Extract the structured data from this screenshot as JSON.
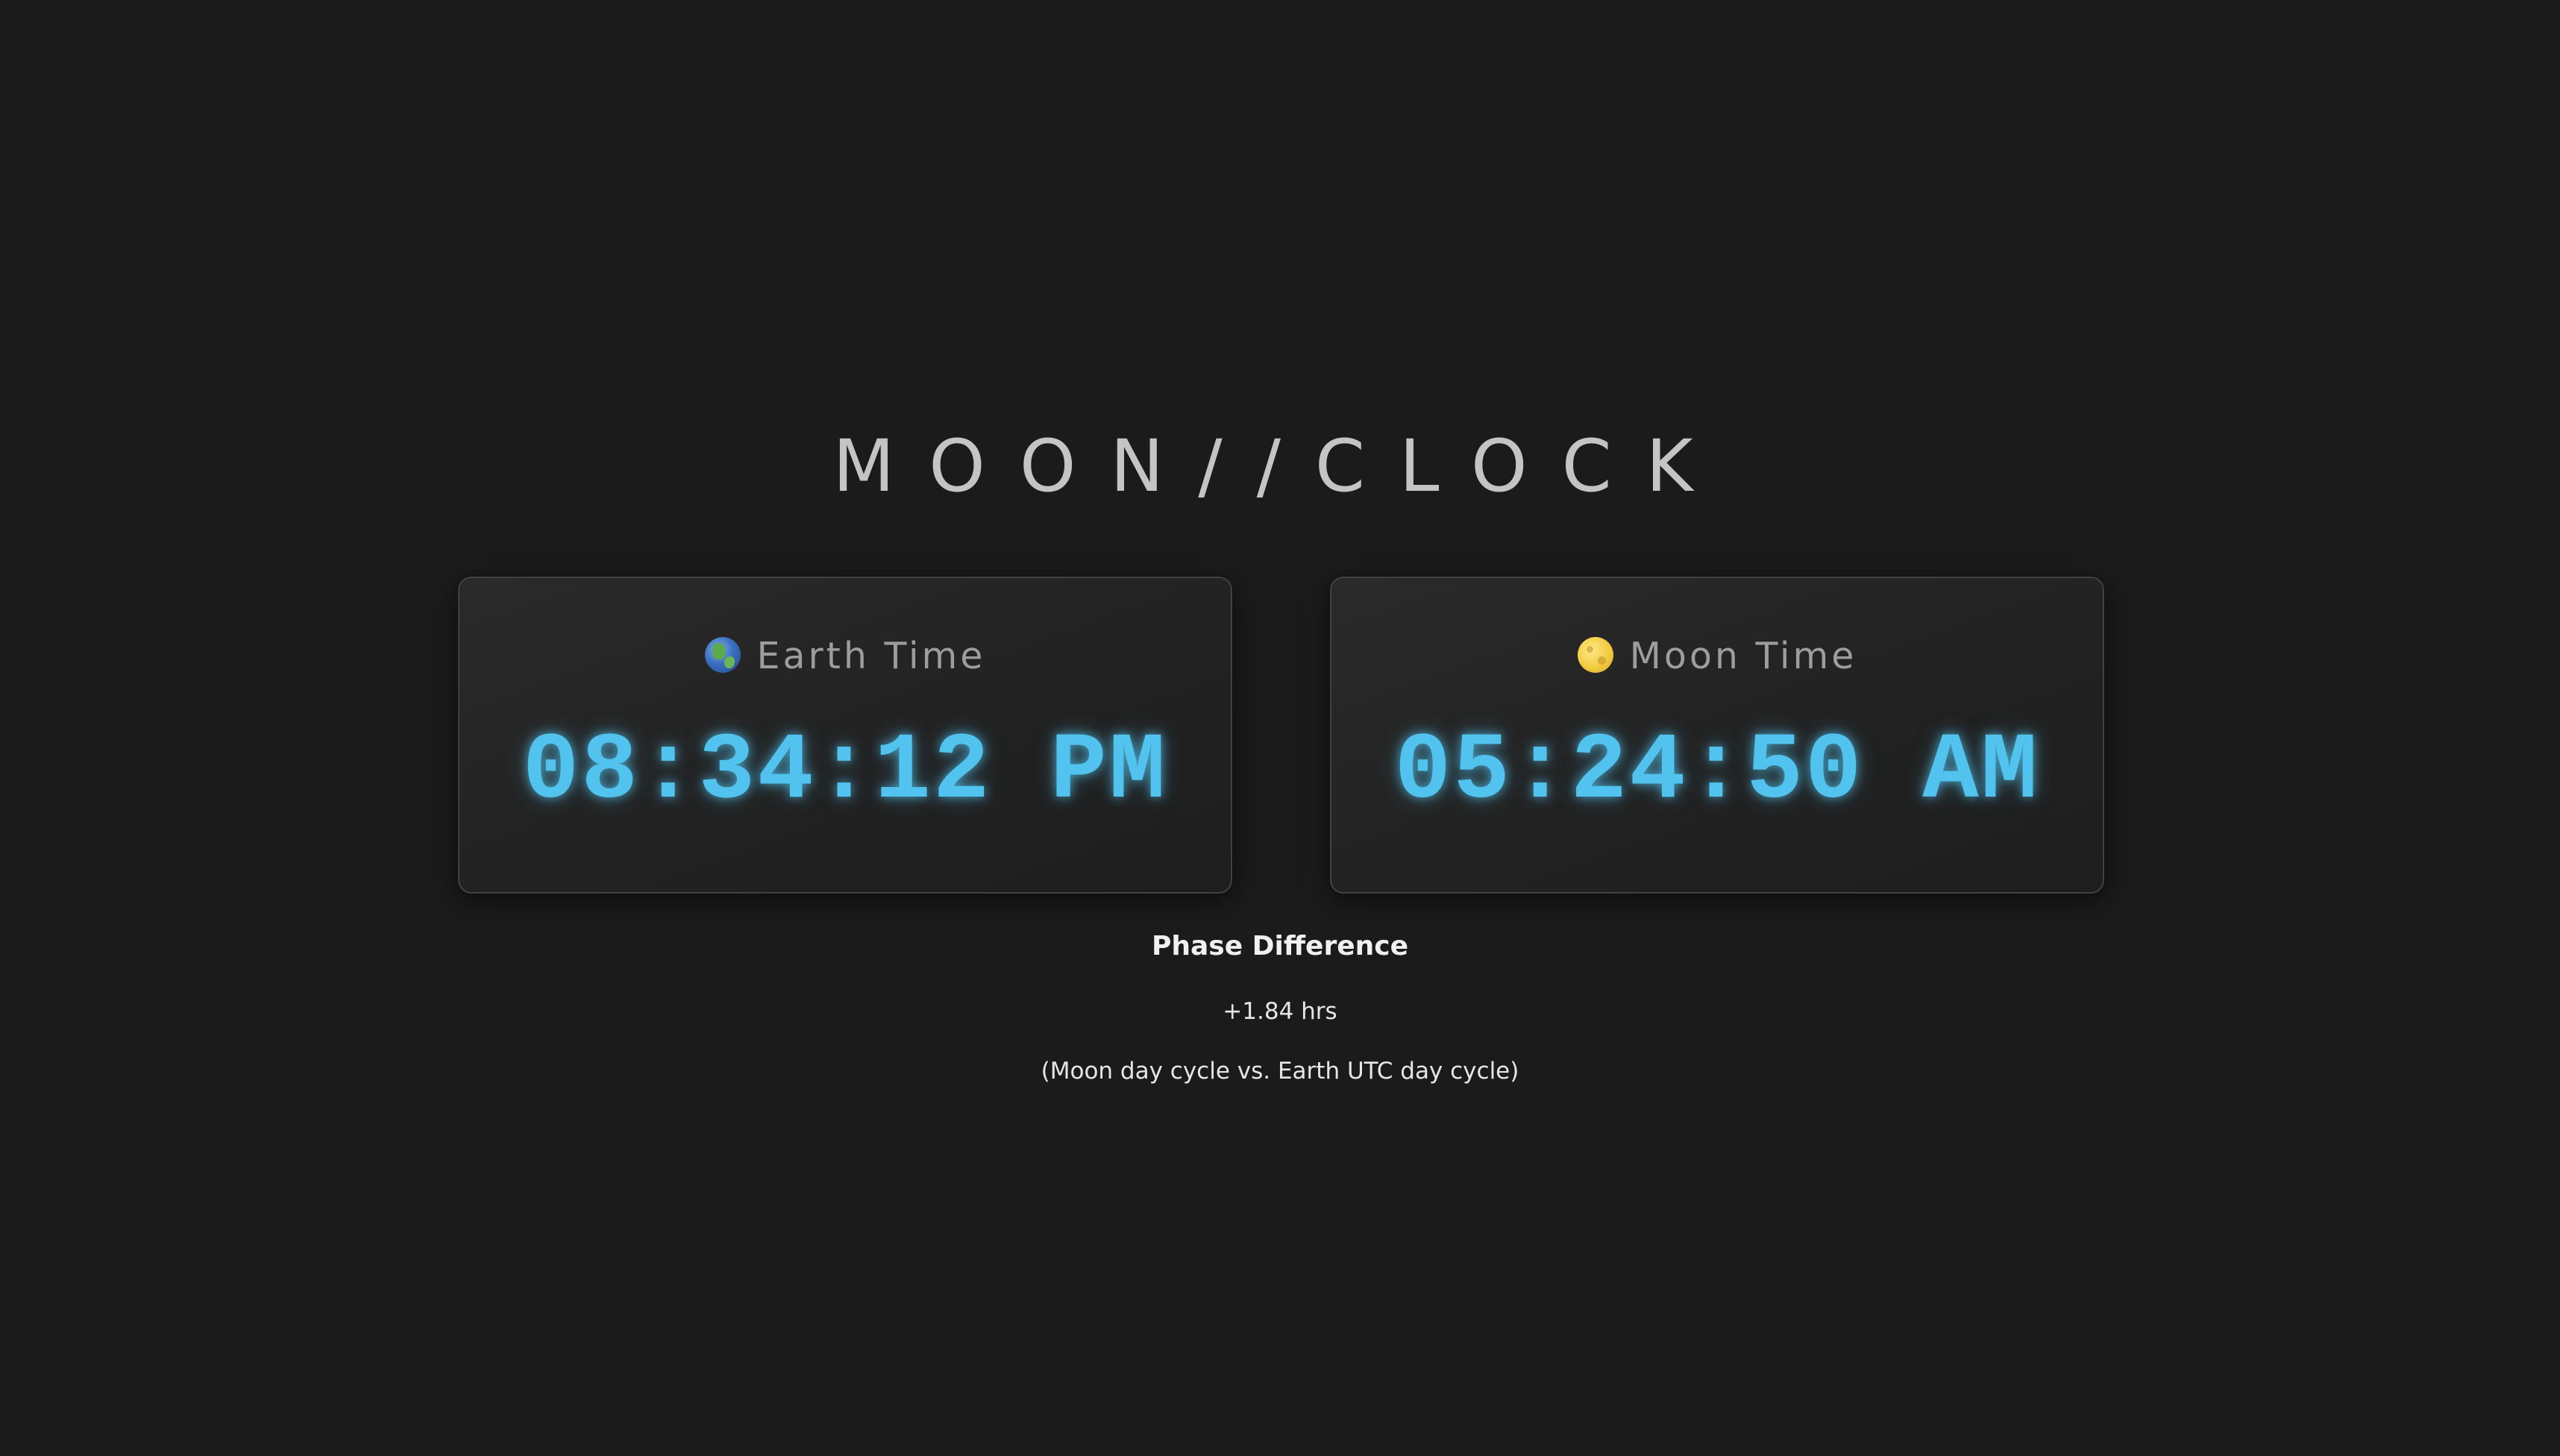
{
  "app": {
    "title": "MOON//CLOCK"
  },
  "earth": {
    "icon": "globe-icon",
    "label": "Earth Time",
    "time": "08:34:12 PM"
  },
  "moon": {
    "icon": "moon-icon",
    "label": "Moon Time",
    "time": "05:24:50 AM"
  },
  "phase": {
    "heading": "Phase Difference",
    "value": "+1.84 hrs",
    "note": "(Moon day cycle vs. Earth UTC day cycle)"
  },
  "colors": {
    "background": "#1b1b1b",
    "accent": "#52c3ef",
    "panel_border": "#424242",
    "title": "#c4c4c4",
    "label": "#9d9d9d"
  }
}
